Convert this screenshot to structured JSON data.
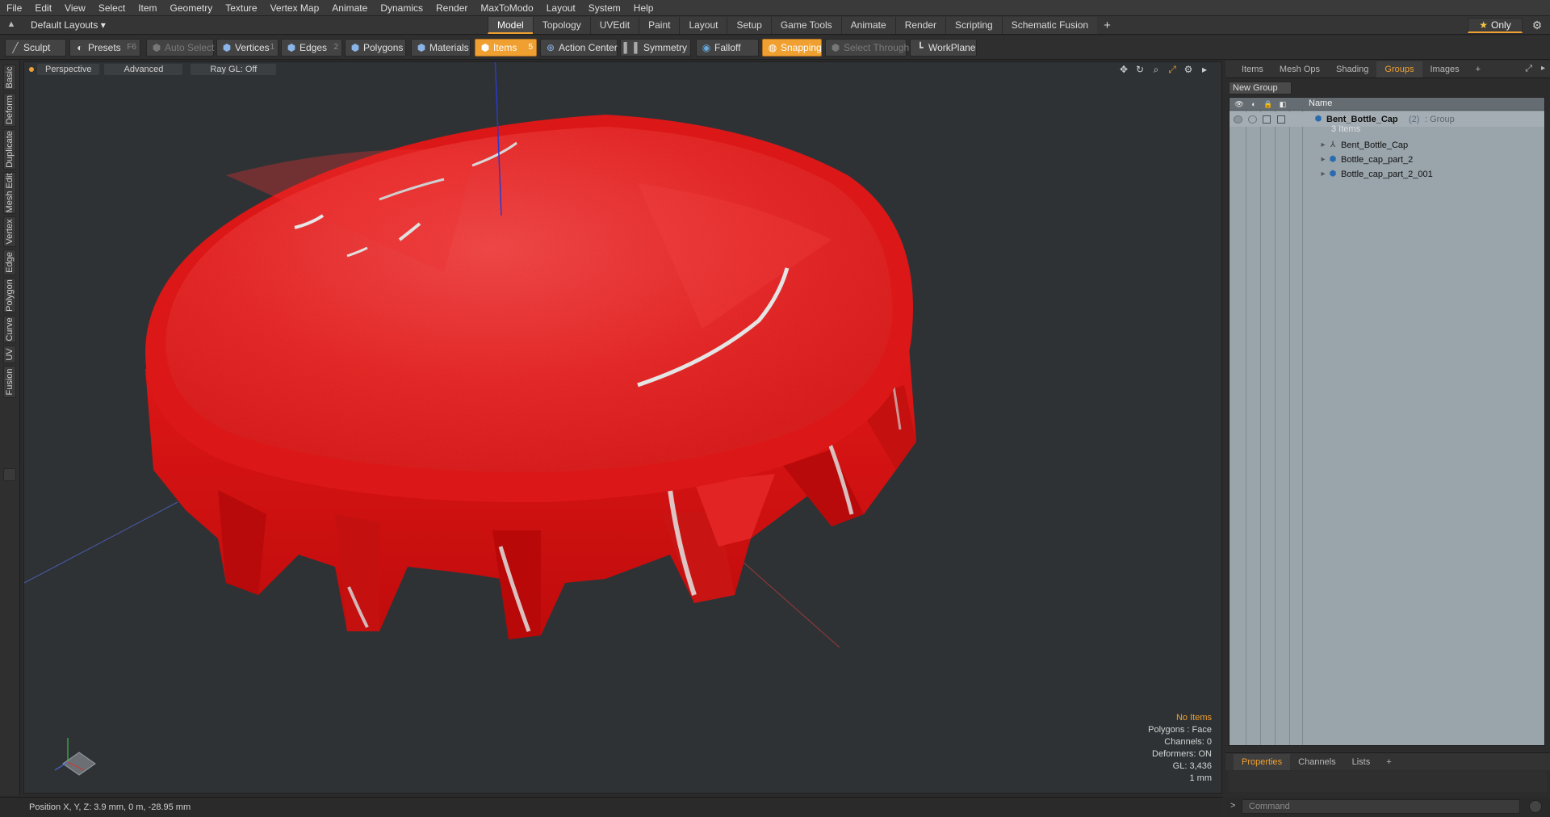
{
  "menu": [
    "File",
    "Edit",
    "View",
    "Select",
    "Item",
    "Geometry",
    "Texture",
    "Vertex Map",
    "Animate",
    "Dynamics",
    "Render",
    "MaxToModo",
    "Layout",
    "System",
    "Help"
  ],
  "layout_dropdown": "Default Layouts ▾",
  "tabs": [
    {
      "label": "Model",
      "active": true
    },
    {
      "label": "Topology",
      "active": false
    },
    {
      "label": "UVEdit",
      "active": false
    },
    {
      "label": "Paint",
      "active": false
    },
    {
      "label": "Layout",
      "active": false
    },
    {
      "label": "Setup",
      "active": false
    },
    {
      "label": "Game Tools",
      "active": false
    },
    {
      "label": "Animate",
      "active": false
    },
    {
      "label": "Render",
      "active": false
    },
    {
      "label": "Scripting",
      "active": false
    },
    {
      "label": "Schematic Fusion",
      "active": false
    }
  ],
  "tab_plus": "+",
  "only_label": "Only",
  "toolbar": {
    "sculpt": "Sculpt",
    "presets": "Presets",
    "presets_key": "F6",
    "auto_select": "Auto Select",
    "vertices": "Vertices",
    "vertices_key": "1",
    "edges": "Edges",
    "edges_key": "2",
    "polygons": "Polygons",
    "materials": "Materials",
    "items": "Items",
    "items_key": "5",
    "action_center": "Action Center",
    "symmetry": "Symmetry",
    "falloff": "Falloff",
    "snapping": "Snapping",
    "select_through": "Select Through",
    "workplane": "WorkPlane"
  },
  "left_tabs": [
    "Basic",
    "Deform",
    "Duplicate",
    "Mesh Edit",
    "Vertex",
    "Edge",
    "Polygon",
    "Curve",
    "UV",
    "Fusion"
  ],
  "viewport": {
    "view_mode": "Perspective",
    "shading": "Advanced",
    "raygl": "Ray GL: Off",
    "info": {
      "selection": "No Items",
      "polygons": "Polygons : Face",
      "channels": "Channels: 0",
      "deformers": "Deformers: ON",
      "gl": "GL: 3,436",
      "unit": "1 mm"
    }
  },
  "status": {
    "position": "Position X, Y, Z:  3.9 mm, 0 m, -28.95 mm"
  },
  "right_panel": {
    "tabs": [
      {
        "label": "Items",
        "active": false
      },
      {
        "label": "Mesh Ops",
        "active": false
      },
      {
        "label": "Shading",
        "active": false
      },
      {
        "label": "Groups",
        "active": true
      },
      {
        "label": "Images",
        "active": false
      }
    ],
    "tab_plus": "+",
    "new_group": "New Group",
    "column_name": "Name",
    "group": {
      "name": "Bent_Bottle_Cap",
      "count": "(2)",
      "type": ": Group",
      "subtitle": "3 Items"
    },
    "items": [
      {
        "name": "Bent_Bottle_Cap",
        "icon": "locator-icon"
      },
      {
        "name": "Bottle_cap_part_2",
        "icon": "mesh-icon"
      },
      {
        "name": "Bottle_cap_part_2_001",
        "icon": "mesh-icon"
      }
    ],
    "bottom_tabs": [
      {
        "label": "Properties",
        "active": true
      },
      {
        "label": "Channels",
        "active": false
      },
      {
        "label": "Lists",
        "active": false
      }
    ],
    "bottom_plus": "+",
    "command_placeholder": "Command",
    "command_prompt": ">"
  },
  "colors": {
    "accent": "#f0a030",
    "cap_red": "#e61212",
    "viewport_bg": "#2e3235"
  }
}
